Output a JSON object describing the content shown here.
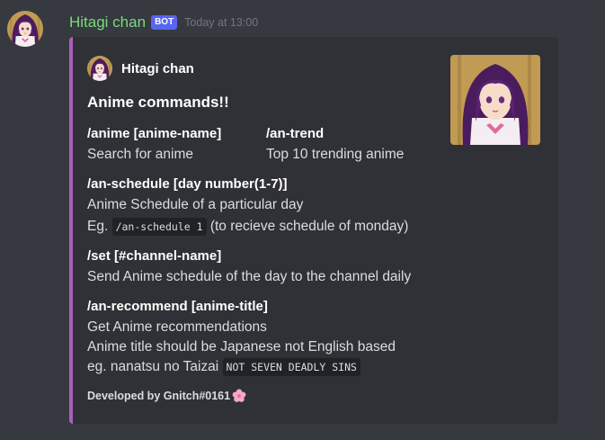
{
  "message": {
    "username": "Hitagi chan",
    "bot_tag": "BOT",
    "timestamp": "Today at 13:00",
    "avatar_icon": "anime-girl-avatar"
  },
  "embed": {
    "accent_color": "#a95fb8",
    "author": {
      "name": "Hitagi chan",
      "icon": "anime-girl-avatar"
    },
    "title": "Anime commands!!",
    "thumbnail_icon": "anime-girl-thumbnail",
    "fields": {
      "anime": {
        "name": "/anime [anime-name]",
        "value": "Search for anime"
      },
      "trend": {
        "name": "/an-trend",
        "value": "Top 10 trending anime"
      },
      "schedule": {
        "name": "/an-schedule [day number(1-7)]",
        "line1": "Anime Schedule of a particular day",
        "line2_prefix": "Eg.",
        "line2_code": "/an-schedule 1",
        "line2_suffix": "(to recieve schedule of monday)"
      },
      "set": {
        "name": "/set [#channel-name]",
        "value": "Send Anime schedule of the day to the channel daily"
      },
      "recommend": {
        "name": "/an-recommend [anime-title]",
        "line1": "Get Anime recommendations",
        "line2": "Anime title should be Japanese not English based",
        "line3_prefix": "eg. nanatsu no Taizai",
        "line3_code": "NOT SEVEN DEADLY SINS"
      }
    },
    "footer": {
      "text": "Developed by Gnitch#0161",
      "icon": "cherry-blossom-icon"
    }
  },
  "colors": {
    "background": "#36393f",
    "embed_background": "#2f3136",
    "username": "#7dd87d",
    "bot_tag": "#5865f2",
    "timestamp": "#72767d"
  }
}
